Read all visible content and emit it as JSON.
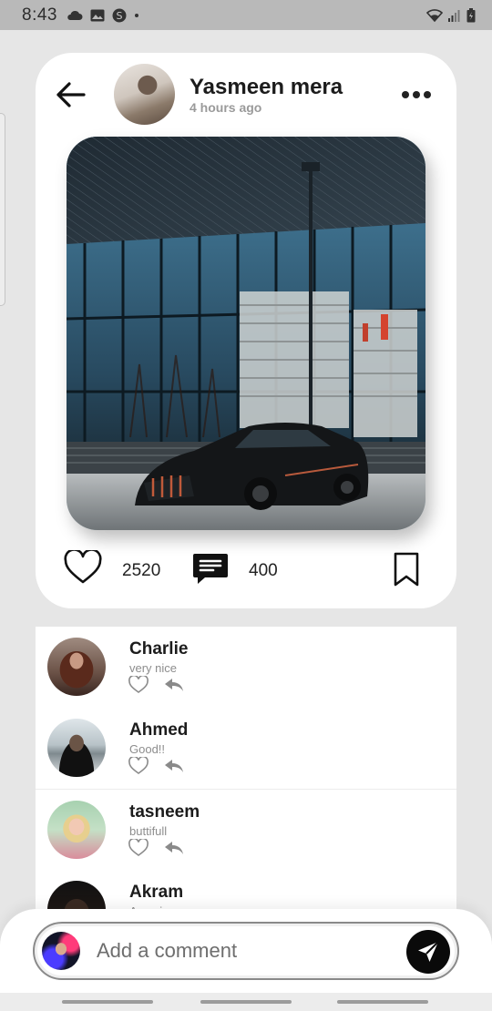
{
  "status_bar": {
    "time": "8:43"
  },
  "post": {
    "author_name": "Yasmeen mera",
    "time_ago": "4 hours ago",
    "likes": "2520",
    "comments": "400"
  },
  "comments": [
    {
      "name": "Charlie",
      "text": "very nice"
    },
    {
      "name": "Ahmed",
      "text": "Good!!"
    },
    {
      "name": "tasneem",
      "text": "buttifull"
    },
    {
      "name": "Akram",
      "text": "Amazing"
    }
  ],
  "comment_bar": {
    "placeholder": "Add a comment"
  }
}
